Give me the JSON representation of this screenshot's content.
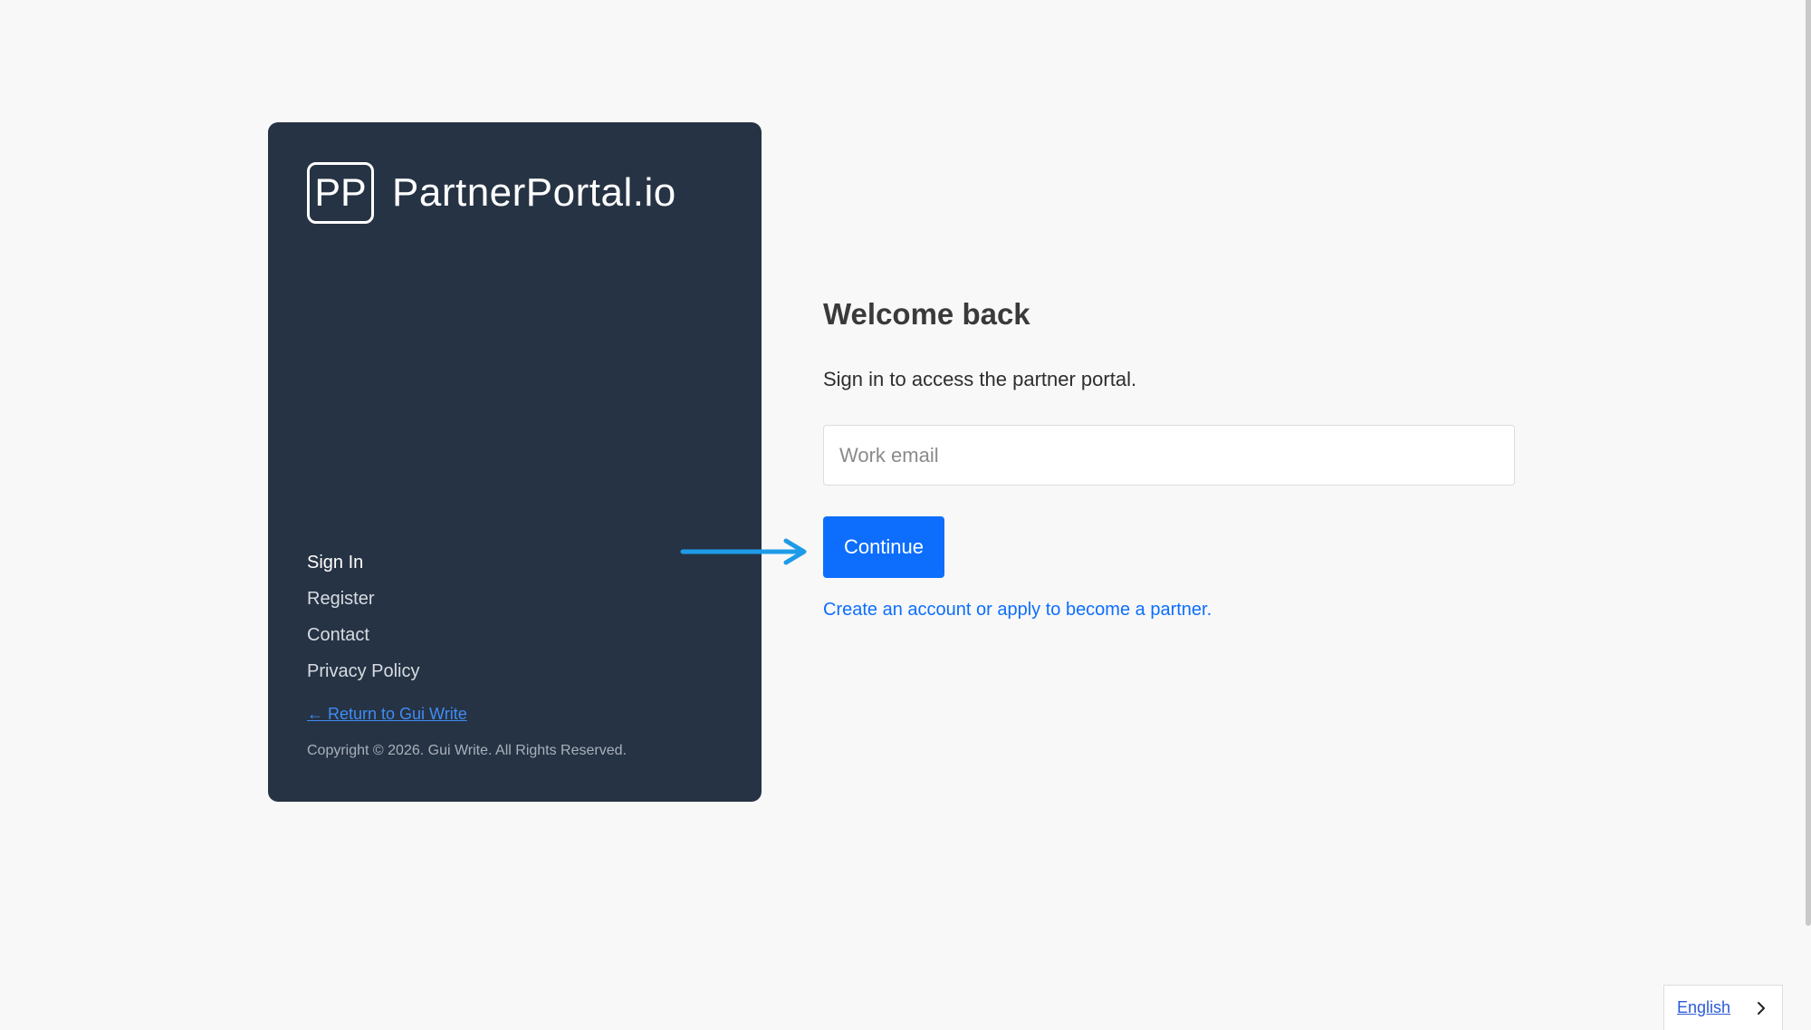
{
  "brand": {
    "logo_initials": "PP",
    "name": "PartnerPortal.io"
  },
  "nav": {
    "items": [
      {
        "label": "Sign In",
        "active": true
      },
      {
        "label": "Register",
        "active": false
      },
      {
        "label": "Contact",
        "active": false
      },
      {
        "label": "Privacy Policy",
        "active": false
      }
    ]
  },
  "return_link": "← Return to Gui Write",
  "copyright": "Copyright © 2026. Gui Write. All Rights Reserved.",
  "login": {
    "heading": "Welcome back",
    "subheading": "Sign in to access the partner portal.",
    "email_placeholder": "Work email",
    "email_value": "",
    "continue_label": "Continue",
    "create_link": "Create an account or apply to become a partner."
  },
  "language": {
    "selected": "English"
  },
  "icons": {
    "annotation_arrow": "arrow-right-icon",
    "language_chevron": "chevron-right-icon"
  },
  "colors": {
    "panel_bg": "#263344",
    "page_bg": "#f8f8f8",
    "accent": "#0d6efd",
    "annotation_arrow": "#1e9be8"
  }
}
